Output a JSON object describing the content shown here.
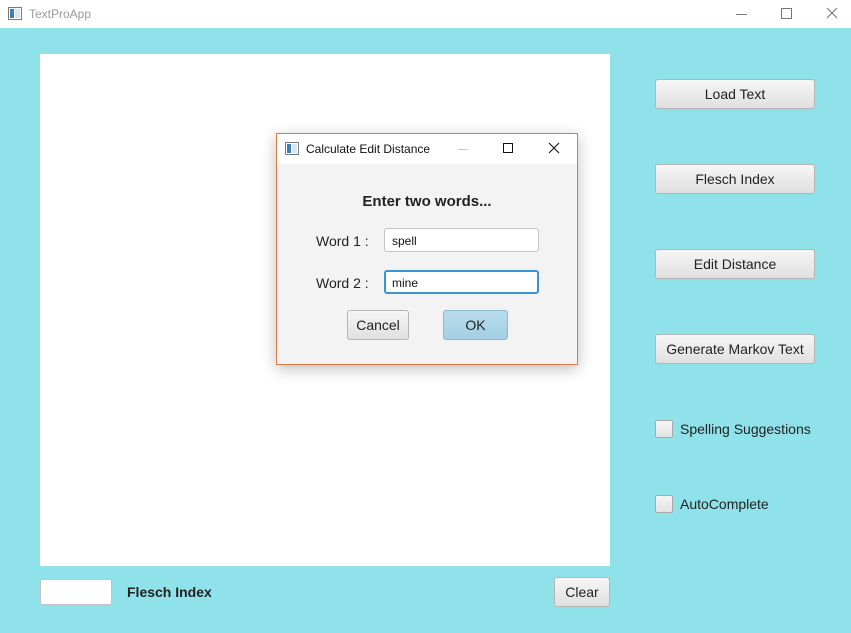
{
  "window": {
    "title": "TextProApp",
    "icons": {
      "app": "app-window-icon",
      "minimize": "minimize-icon",
      "maximize": "maximize-icon",
      "close": "close-icon"
    }
  },
  "sidebar": {
    "buttons": [
      {
        "label": "Load Text"
      },
      {
        "label": "Flesch Index"
      },
      {
        "label": "Edit Distance"
      },
      {
        "label": "Generate Markov Text"
      }
    ],
    "checkboxes": [
      {
        "label": "Spelling Suggestions",
        "checked": false
      },
      {
        "label": "AutoComplete",
        "checked": false
      }
    ]
  },
  "editor": {
    "text": ""
  },
  "footer": {
    "flesch_value": "",
    "flesch_label": "Flesch Index",
    "clear_label": "Clear"
  },
  "dialog": {
    "title": "Calculate Edit Distance",
    "heading": "Enter two words...",
    "word1_label": "Word 1 :",
    "word1_value": "spell",
    "word2_label": "Word 2 :",
    "word2_value": "mine",
    "cancel_label": "Cancel",
    "ok_label": "OK"
  },
  "colors": {
    "background": "#8fe2ea",
    "dialog_border": "#e07a45",
    "focus_ring": "#3a93d3",
    "default_button": "#a3cfe4"
  }
}
